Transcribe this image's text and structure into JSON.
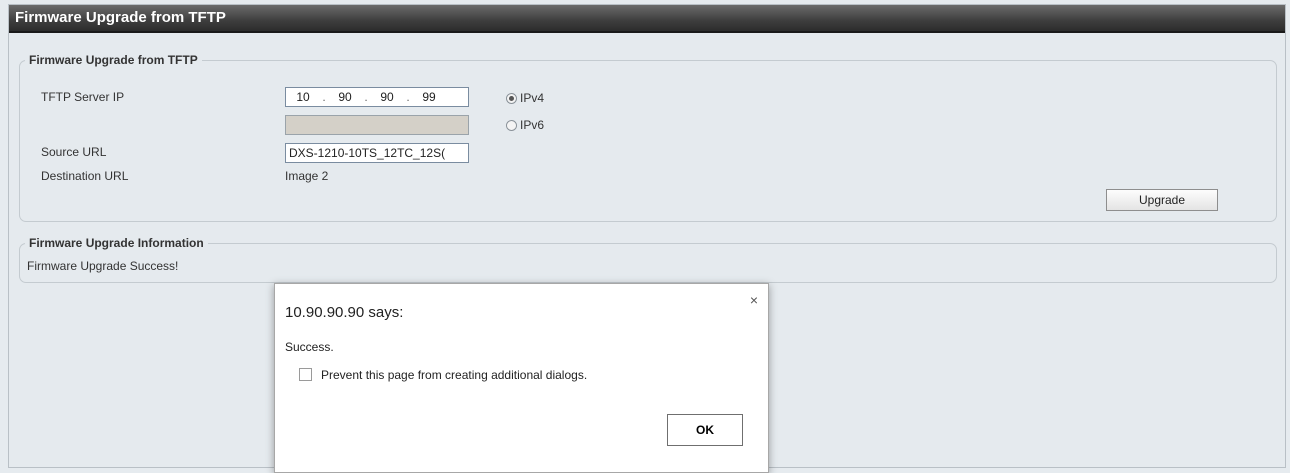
{
  "page": {
    "title": "Firmware Upgrade from TFTP"
  },
  "upgrade_section": {
    "legend": "Firmware Upgrade from TFTP",
    "server_ip_label": "TFTP Server IP",
    "ip_octets": [
      "10",
      "90",
      "90",
      "99"
    ],
    "ip_separator": ".",
    "ipv4_label": "IPv4",
    "ipv6_label": "IPv6",
    "ipv4_selected": true,
    "source_url_label": "Source URL",
    "source_url_value": "DXS-1210-10TS_12TC_12S(",
    "destination_url_label": "Destination URL",
    "destination_url_value": "Image 2",
    "upgrade_button": "Upgrade"
  },
  "info_section": {
    "legend": "Firmware Upgrade Information",
    "message": "Firmware Upgrade Success!"
  },
  "dialog": {
    "title": "10.90.90.90 says:",
    "message": "Success.",
    "prevent_label": "Prevent this page from creating additional dialogs.",
    "ok_button": "OK",
    "close_glyph": "×"
  }
}
